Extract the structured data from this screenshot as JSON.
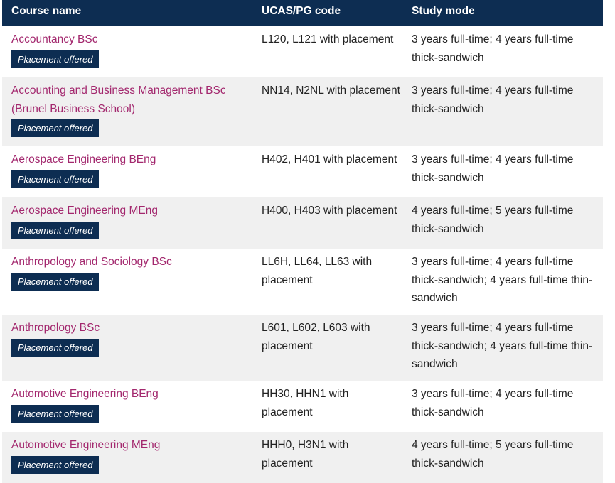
{
  "table": {
    "headers": [
      "Course name",
      "UCAS/PG code",
      "Study mode"
    ],
    "badge_label": "Placement offered",
    "rows": [
      {
        "course": "Accountancy BSc",
        "code": "L120, L121 with placement",
        "mode": "3 years full-time; 4 years full-time thick-sandwich",
        "badge": "Placement offered"
      },
      {
        "course": "Accounting and Business Management BSc (Brunel Business School)",
        "code": "NN14, N2NL with placement",
        "mode": "3 years full-time; 4 years full-time thick-sandwich",
        "badge": "Placement offered"
      },
      {
        "course": "Aerospace Engineering BEng",
        "code": "H402, H401 with placement",
        "mode": "3 years full-time; 4 years full-time thick-sandwich",
        "badge": "Placement offered"
      },
      {
        "course": "Aerospace Engineering MEng",
        "code": "H400, H403 with placement",
        "mode": "4 years full-time; 5 years full-time thick-sandwich",
        "badge": "Placement offered"
      },
      {
        "course": "Anthropology and Sociology BSc",
        "code": "LL6H, LL64, LL63 with placement",
        "mode": "3 years full-time; 4 years full-time thick-sandwich; 4 years full-time thin-sandwich",
        "badge": "Placement offered"
      },
      {
        "course": "Anthropology BSc",
        "code": "L601, L602, L603 with placement",
        "mode": "3 years full-time; 4 years full-time thick-sandwich; 4 years full-time thin-sandwich",
        "badge": "Placement offered"
      },
      {
        "course": "Automotive Engineering BEng",
        "code": "HH30, HHN1 with placement",
        "mode": "3 years full-time; 4 years full-time thick-sandwich",
        "badge": "Placement offered"
      },
      {
        "course": "Automotive Engineering MEng",
        "code": "HHH0, H3N1 with placement",
        "mode": "4 years full-time; 5 years full-time thick-sandwich",
        "badge": "Placement offered"
      }
    ]
  },
  "colors": {
    "header_bg": "#0d2d52",
    "link": "#a3286e",
    "alt_row_bg": "#f0f0f0"
  }
}
